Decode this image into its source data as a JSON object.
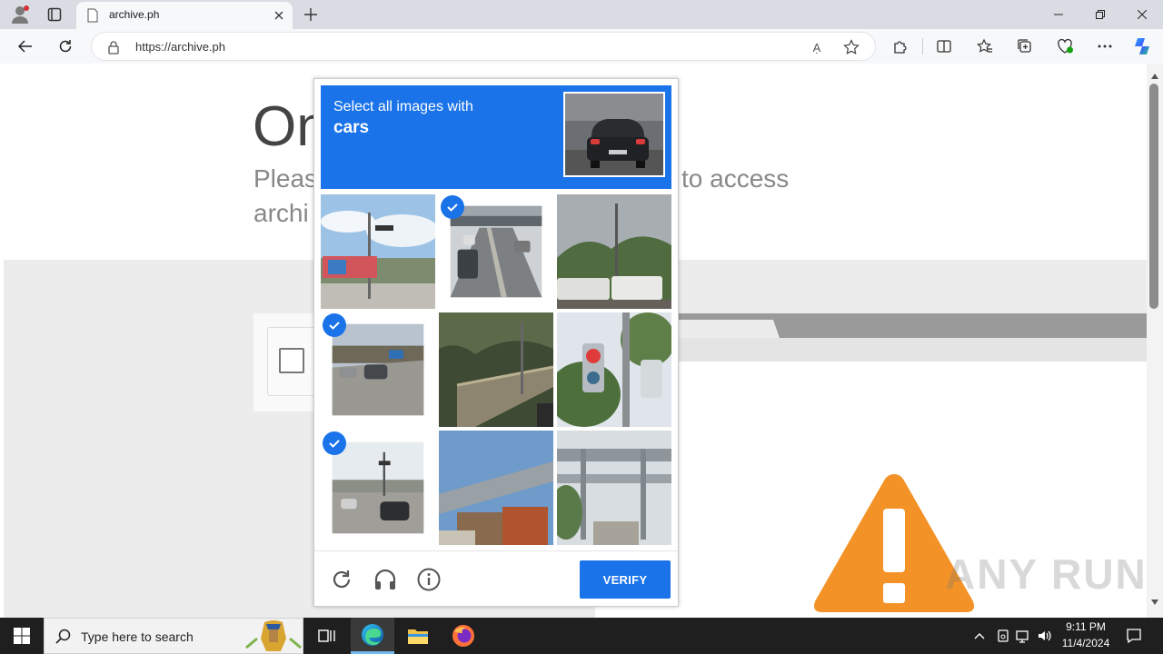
{
  "browser": {
    "tab_title": "archive.ph",
    "url": "https://archive.ph",
    "read_aloud_label": "Ạ"
  },
  "page": {
    "heading": "On",
    "subtext_line1": "Pleas",
    "subtext_line1_end": "to access",
    "subtext_line2": "archi"
  },
  "captcha": {
    "prompt_line1": "Select all images with",
    "prompt_line2": "cars",
    "verify_label": "VERIFY",
    "tiles": [
      {
        "name": "billboard-street",
        "selected": false
      },
      {
        "name": "highway-cars",
        "selected": true
      },
      {
        "name": "rv-parking",
        "selected": false
      },
      {
        "name": "road-cars",
        "selected": true
      },
      {
        "name": "bridge-trees",
        "selected": false
      },
      {
        "name": "traffic-light",
        "selected": false
      },
      {
        "name": "intersection-cars",
        "selected": true
      },
      {
        "name": "overpass-truck",
        "selected": false
      },
      {
        "name": "elevated-rail",
        "selected": false
      }
    ],
    "colors": {
      "accent": "#1a73e8"
    }
  },
  "watermark": "ANY RUN",
  "taskbar": {
    "search_placeholder": "Type here to search",
    "time": "9:11 PM",
    "date": "11/4/2024"
  }
}
